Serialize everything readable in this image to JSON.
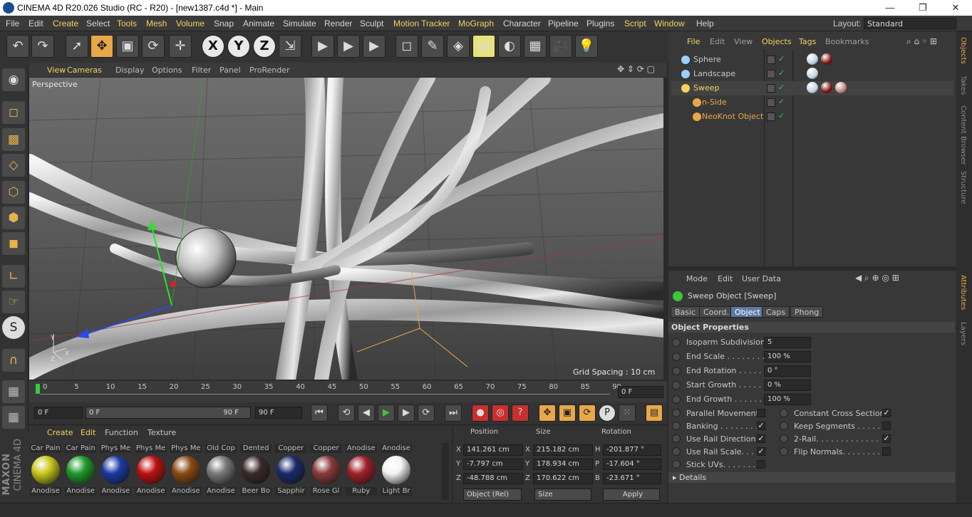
{
  "title": "CINEMA 4D R20.026 Studio (RC - R20) - [new1387.c4d *] - Main",
  "window_buttons": [
    "—",
    "❐",
    "✕"
  ],
  "menu": [
    {
      "label": "File",
      "hl": false
    },
    {
      "label": "Edit",
      "hl": false
    },
    {
      "label": "Create",
      "hl": true
    },
    {
      "label": "Select",
      "hl": false
    },
    {
      "label": "Tools",
      "hl": true
    },
    {
      "label": "Mesh",
      "hl": true
    },
    {
      "label": "Volume",
      "hl": true
    },
    {
      "label": "Snap",
      "hl": false
    },
    {
      "label": "Animate",
      "hl": false
    },
    {
      "label": "Simulate",
      "hl": false
    },
    {
      "label": "Render",
      "hl": false
    },
    {
      "label": "Sculpt",
      "hl": false
    },
    {
      "label": "Motion Tracker",
      "hl": true
    },
    {
      "label": "MoGraph",
      "hl": true
    },
    {
      "label": "Character",
      "hl": false
    },
    {
      "label": "Pipeline",
      "hl": false
    },
    {
      "label": "Plugins",
      "hl": false
    },
    {
      "label": "Script",
      "hl": true
    },
    {
      "label": "Window",
      "hl": true
    },
    {
      "label": "Help",
      "hl": false
    }
  ],
  "layout": {
    "label": "Layout:",
    "value": "Standard"
  },
  "toolbar_icons": [
    "undo-icon",
    "redo-icon",
    "select-icon",
    "move-icon",
    "scale-icon",
    "rotate-icon",
    "move-add-icon",
    "x-axis-icon",
    "y-axis-icon",
    "z-axis-icon",
    "coordinate-system-icon",
    "render-view-icon",
    "render-picture-viewer-icon",
    "edit-render-settings-icon",
    "cube-icon",
    "pen-icon",
    "subdivision-icon",
    "array-icon",
    "deformer-icon",
    "floor-icon",
    "camera-icon",
    "light-icon"
  ],
  "toolbar_glyphs": [
    "↶",
    "↷",
    "➚",
    "✥",
    "▣",
    "⟳",
    "✛",
    "X",
    "Y",
    "Z",
    "⇲",
    "▶",
    "▶",
    "▶",
    "◻",
    "✎",
    "◈",
    "▤",
    "◐",
    "▦",
    "🎥",
    "💡"
  ],
  "viewport_menu": [
    "View",
    "Cameras",
    "Display",
    "Options",
    "Filter",
    "Panel",
    "ProRender"
  ],
  "viewport": {
    "label": "Perspective",
    "grid_spacing": "Grid Spacing : 10 cm"
  },
  "timeline": {
    "ticks": [
      "0",
      "5",
      "10",
      "15",
      "20",
      "25",
      "30",
      "35",
      "40",
      "45",
      "50",
      "55",
      "60",
      "65",
      "70",
      "75",
      "80",
      "85",
      "90"
    ],
    "current": "0 F"
  },
  "playback": {
    "start": "0 F",
    "range_start": "0 F",
    "range_end": "90 F",
    "end": "90 F"
  },
  "material_menu": [
    "Create",
    "Edit",
    "Function",
    "Texture"
  ],
  "materials": [
    {
      "top": "Car Pain",
      "bottom": "Anodise",
      "color": "#c8c81a"
    },
    {
      "top": "Car Pain",
      "bottom": "Anodise",
      "color": "#1e9a2a"
    },
    {
      "top": "Phys Me",
      "bottom": "Anodise",
      "color": "#1a3aa6"
    },
    {
      "top": "Phys Me",
      "bottom": "Anodise",
      "color": "#c01010"
    },
    {
      "top": "Phys Me",
      "bottom": "Anodise",
      "color": "#8a4a12"
    },
    {
      "top": "Old Cop",
      "bottom": "Anodise",
      "color": "#7a7a7a"
    },
    {
      "top": "Dented",
      "bottom": "Beer Bo",
      "color": "#3a2a2a"
    },
    {
      "top": "Copper",
      "bottom": "Sapphir",
      "color": "#1a2a6a"
    },
    {
      "top": "Copper",
      "bottom": "Rose Gl",
      "color": "#8a3a3a"
    },
    {
      "top": "Anodise",
      "bottom": "Ruby",
      "color": "#a0202a"
    },
    {
      "top": "Anodise",
      "bottom": "Light Br",
      "color": "#f4f4f4"
    }
  ],
  "coordinates": {
    "headers": [
      "Position",
      "Size",
      "Rotation"
    ],
    "rows": [
      {
        "axis": "X",
        "pos": "141.261 cm",
        "saxis": "X",
        "size": "215.182 cm",
        "raxis": "H",
        "rot": "-201.877 °"
      },
      {
        "axis": "Y",
        "pos": "-7.797 cm",
        "saxis": "Y",
        "size": "178.934 cm",
        "raxis": "P",
        "rot": "-17.604 °"
      },
      {
        "axis": "Z",
        "pos": "-48.788 cm",
        "saxis": "Z",
        "size": "170.622 cm",
        "raxis": "B",
        "rot": "-23.671 °"
      }
    ],
    "mode": "Object (Rel)",
    "size_mode": "Size",
    "apply": "Apply"
  },
  "object_manager": {
    "menu": [
      {
        "label": "File",
        "hl": true
      },
      {
        "label": "Edit",
        "hl": false
      },
      {
        "label": "View",
        "hl": false
      },
      {
        "label": "Objects",
        "hl": true
      },
      {
        "label": "Tags",
        "hl": true
      },
      {
        "label": "Bookmarks",
        "hl": false
      }
    ],
    "objects": [
      {
        "name": "Sphere",
        "indent": 0,
        "color": "#9bd0ff"
      },
      {
        "name": "Landscape",
        "indent": 0,
        "color": "#9bd0ff"
      },
      {
        "name": "Sweep",
        "indent": 0,
        "color": "#f2d45c"
      },
      {
        "name": "n-Side",
        "indent": 1,
        "color": "#e8a84a"
      },
      {
        "name": "NeoKnot Object",
        "indent": 1,
        "color": "#e8a84a"
      }
    ]
  },
  "attributes": {
    "menu": [
      "Mode",
      "Edit",
      "User Data"
    ],
    "title": "Sweep Object [Sweep]",
    "tabs": [
      {
        "label": "Basic",
        "on": false
      },
      {
        "label": "Coord.",
        "on": false
      },
      {
        "label": "Object",
        "on": true
      },
      {
        "label": "Caps",
        "on": false
      },
      {
        "label": "Phong",
        "on": false
      }
    ],
    "section": "Object Properties",
    "fields": [
      {
        "label": "Isoparm Subdivision",
        "value": "5"
      },
      {
        "label": "End Scale . . . . . . . . .",
        "value": "100 %"
      },
      {
        "label": "End Rotation . . . . . .",
        "value": "0 °"
      },
      {
        "label": "Start Growth . . . . . .",
        "value": "0 %"
      },
      {
        "label": "End Growth . . . . . . .",
        "value": "100 %"
      }
    ],
    "checks_left": [
      {
        "label": "Parallel Movement",
        "checked": false
      },
      {
        "label": "Banking . . . . . . . . .",
        "checked": true
      },
      {
        "label": "Use Rail Direction",
        "checked": true
      },
      {
        "label": "Use Rail Scale. . . .",
        "checked": true
      },
      {
        "label": "Stick UVs. . . . . . . .",
        "checked": false
      }
    ],
    "checks_right": [
      {
        "label": "Constant Cross Section",
        "checked": true
      },
      {
        "label": "Keep Segments . . . . . .",
        "checked": false
      },
      {
        "label": "2-Rail. . . . . . . . . . . . .",
        "checked": true
      },
      {
        "label": "Flip Normals. . . . . . . . .",
        "checked": false
      }
    ],
    "details": "Details"
  },
  "side_tabs_top": [
    "Objects",
    "Takes",
    "Content Browser",
    "Structure"
  ],
  "side_tabs_bottom": [
    "Attributes",
    "Layers"
  ],
  "logo": {
    "brand": "MAXON",
    "product": "CINEMA 4D"
  }
}
